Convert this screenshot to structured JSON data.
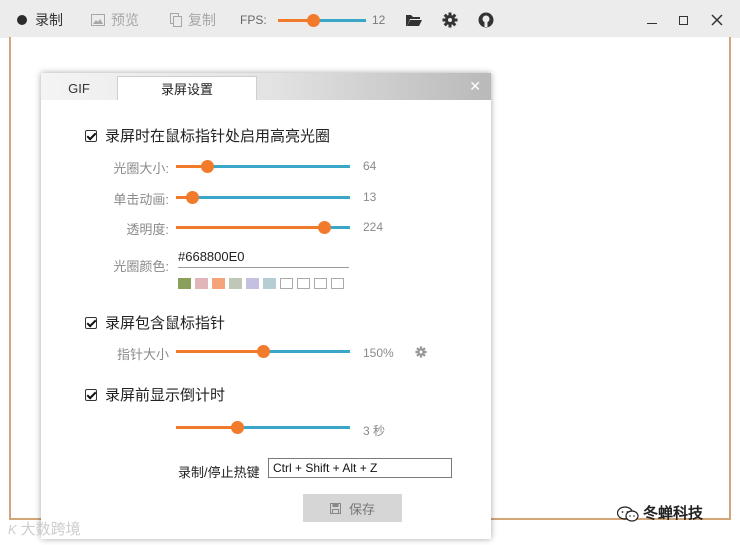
{
  "toolbar": {
    "record_label": "录制",
    "preview_label": "预览",
    "copy_label": "复制",
    "fps_label": "FPS:",
    "fps_value": "12",
    "fps_fraction": 0.4
  },
  "dialog": {
    "tabs": [
      "GIF",
      "录屏设置"
    ],
    "close_label": "✕",
    "highlight": {
      "checkbox_label": "录屏时在鼠标指针处启用高亮光圈",
      "size": {
        "label": "光圈大小:",
        "value": "64",
        "fraction": 0.18
      },
      "click_anim": {
        "label": "单击动画:",
        "value": "13",
        "fraction": 0.09
      },
      "opacity": {
        "label": "透明度:",
        "value": "224",
        "fraction": 0.85
      },
      "color": {
        "label": "光圈颜色:",
        "value": "#668800E0"
      },
      "swatches": [
        "#8aa05a",
        "#e0b6b8",
        "#f5a37a",
        "#bfc8b8",
        "#c3c1df",
        "#b7cdd4",
        "#ffffff",
        "#ffffff",
        "#ffffff",
        "#ffffff"
      ]
    },
    "cursor": {
      "checkbox_label": "录屏包含鼠标指针",
      "size": {
        "label": "指针大小",
        "value": "150%",
        "fraction": 0.5
      }
    },
    "countdown": {
      "checkbox_label": "录屏前显示倒计时",
      "slider": {
        "value": "3 秒",
        "fraction": 0.35
      }
    },
    "hotkey": {
      "label": "录制/停止热键",
      "value": "Ctrl + Shift + Alt + Z"
    },
    "save_label": "保存"
  },
  "watermarks": {
    "left": "大数跨境",
    "right": "冬蝉科技"
  },
  "colors": {
    "orange": "#f27a2b",
    "blue": "#3aa7c9"
  }
}
